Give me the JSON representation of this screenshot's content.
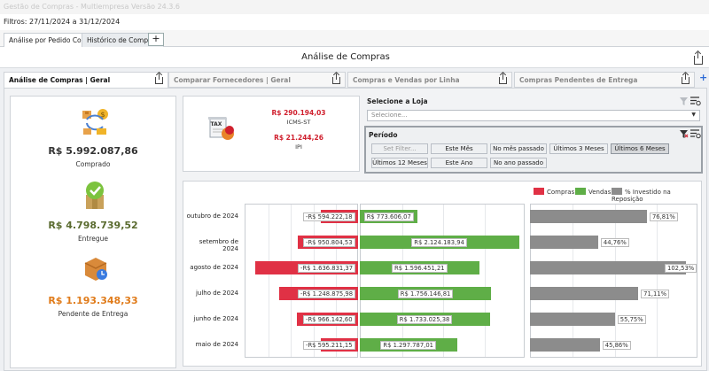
{
  "window": {
    "title": "Gestão de Compras - Multiempresa Versão 24.3.6"
  },
  "filters": {
    "text": "Filtros: 27/11/2024 a 31/12/2024"
  },
  "top_tabs": [
    {
      "label": "Análise por Pedido Compra"
    },
    {
      "label": "Histórico de Compras"
    }
  ],
  "header": {
    "title": "Análise de Compras"
  },
  "sub_tabs": [
    {
      "label": "Análise de Compras | Geral"
    },
    {
      "label": "Comparar Fornecedores | Geral"
    },
    {
      "label": "Compras e Vendas por Linha"
    },
    {
      "label": "Compras Pendentes de Entrega"
    }
  ],
  "summary": {
    "comprado": {
      "value": "R$ 5.992.087,86",
      "label": "Comprado",
      "color": "#333333"
    },
    "entregue": {
      "value": "R$ 4.798.739,52",
      "label": "Entregue",
      "color": "#5a6b2f"
    },
    "pendente": {
      "value": "R$ 1.193.348,33",
      "label": "Pendente de Entrega",
      "color": "#e07b1a"
    }
  },
  "taxes": {
    "icon": "TAX",
    "icms_value": "R$ 290.194,03",
    "icms_label": "ICMS-ST",
    "ipi_value": "R$ 21.244,26",
    "ipi_label": "IPI",
    "value_color": "#d0202e"
  },
  "store": {
    "label": "Selecione a Loja",
    "placeholder": "Selecione..."
  },
  "period": {
    "label": "Período",
    "buttons": [
      "Set Filter...",
      "Este Mês",
      "No mês passado",
      "Últimos 3 Meses",
      "Últimos 6 Meses",
      "Últimos 12 Meses",
      "Este Ano",
      "No ano passado"
    ],
    "selected": "Últimos 6 Meses"
  },
  "colors": {
    "compras": "#e03145",
    "vendas": "#5fae47",
    "investido": "#8c8c8c"
  },
  "chart_data": {
    "type": "bar",
    "orientation": "horizontal",
    "categories": [
      "outubro de 2024",
      "setembro de 2024",
      "agosto de 2024",
      "julho de 2024",
      "junho de 2024",
      "maio de 2024"
    ],
    "series": [
      {
        "name": "Compras",
        "values": [
          -594222.18,
          -950804.53,
          -1636831.37,
          -1248875.98,
          -966142.6,
          -595211.15
        ],
        "labels": [
          "-R$ 594.222,18",
          "-R$ 950.804,53",
          "-R$ 1.636.831,37",
          "-R$ 1.248.875,98",
          "-R$ 966.142,60",
          "-R$ 595.211,15"
        ]
      },
      {
        "name": "Vendas",
        "values": [
          773606.07,
          2124183.94,
          1596451.21,
          1756146.81,
          1733025.38,
          1297787.01
        ],
        "labels": [
          "R$ 773.606,07",
          "R$ 2.124.183,94",
          "R$ 1.596.451,21",
          "R$ 1.756.146,81",
          "R$ 1.733.025,38",
          "R$ 1.297.787,01"
        ]
      },
      {
        "name": "% Investido na Reposição",
        "values": [
          76.81,
          44.76,
          102.53,
          71.11,
          55.75,
          45.86
        ],
        "labels": [
          "76,81%",
          "44,76%",
          "102,53%",
          "71,11%",
          "55,75%",
          "45,86%"
        ]
      }
    ],
    "legend_position": "top-right",
    "grid": true
  }
}
